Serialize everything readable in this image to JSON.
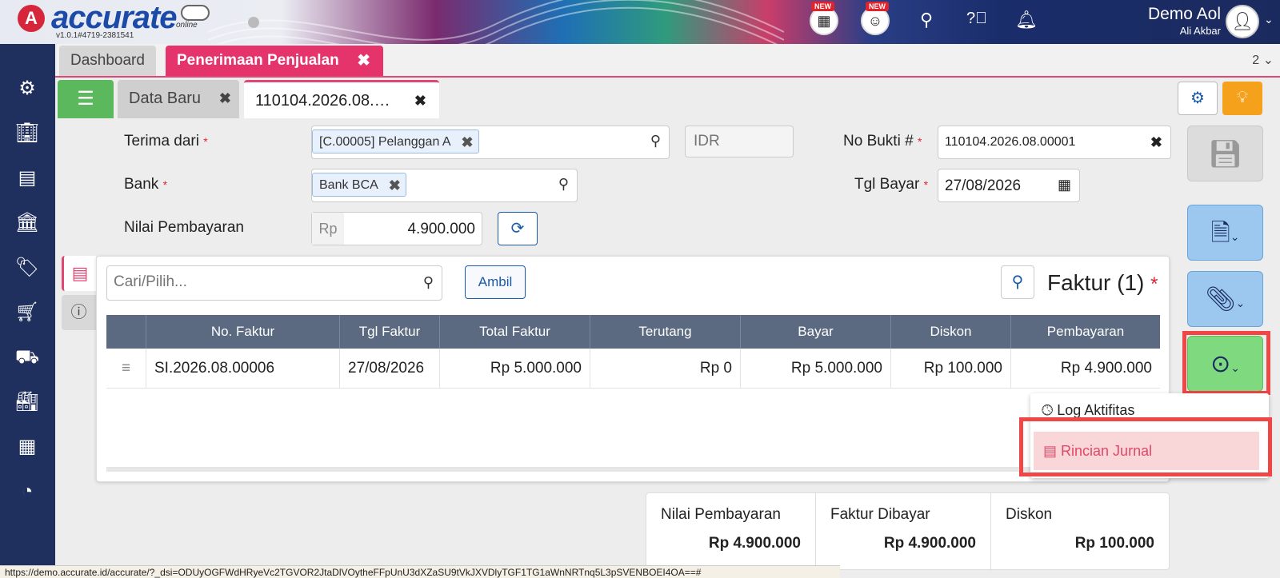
{
  "app": {
    "logo_letter": "A",
    "name": "accurate",
    "tagline": "online",
    "version": "v1.0.1#4719-2381541",
    "new_badge_1": "NEW",
    "new_badge_2": "NEW",
    "user_name": "Demo Aol",
    "user_sub": "Ali Akbar"
  },
  "main_tabs": {
    "dashboard": "Dashboard",
    "active": "Penerimaan Penjualan",
    "count": "2 ⌄"
  },
  "sub_tabs": {
    "new": "Data Baru",
    "doc": "110104.2026.08.…"
  },
  "form": {
    "terima_dari_label": "Terima dari",
    "terima_dari_value": "[C.00005] Pelanggan A",
    "currency_placeholder": "IDR",
    "no_bukti_label": "No Bukti #",
    "no_bukti_value": "110104.2026.08.00001",
    "bank_label": "Bank",
    "bank_value": "Bank BCA",
    "tgl_bayar_label": "Tgl Bayar",
    "tgl_bayar_value": "27/08/2026",
    "nilai_label": "Nilai Pembayaran",
    "nilai_prefix": "Rp",
    "nilai_value": "4.900.000",
    "required_mark": "*"
  },
  "invoice": {
    "search_placeholder": "Cari/Pilih...",
    "ambil_label": "Ambil",
    "title": "Faktur (1)",
    "columns": [
      "No. Faktur",
      "Tgl Faktur",
      "Total Faktur",
      "Terutang",
      "Bayar",
      "Diskon",
      "Pembayaran"
    ],
    "rows": [
      [
        "SI.2026.08.00006",
        "27/08/2026",
        "Rp 5.000.000",
        "Rp 0",
        "Rp 5.000.000",
        "Rp 100.000",
        "Rp 4.900.000"
      ]
    ]
  },
  "dropdown": {
    "log": "Log Aktifitas",
    "rincian": "Rincian Jurnal"
  },
  "summary": {
    "nilai_label": "Nilai Pembayaran",
    "nilai_value": "Rp 4.900.000",
    "faktur_label": "Faktur Dibayar",
    "faktur_value": "Rp 4.900.000",
    "diskon_label": "Diskon",
    "diskon_value": "Rp 100.000"
  },
  "status_url": "https://demo.accurate.id/accurate/?_dsi=ODUyOGFWdHRyeVc2TGVOR2JtaDlVOytheFFpUnU3dXZaSU9tVkJXVDlyTGF1TG1aWnNRTnq5L3pSVENBOEI4OA==#",
  "colors": {
    "brand_pink": "#e4346b",
    "sidebar": "#1f2f5e",
    "accent_blue": "#1a5aa8",
    "highlight_red": "#f04646"
  }
}
